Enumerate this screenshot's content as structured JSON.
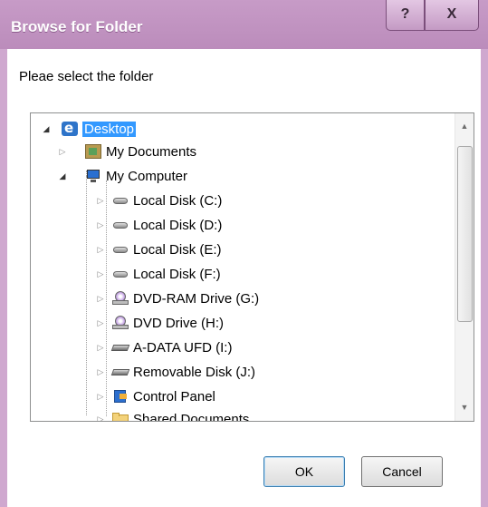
{
  "window": {
    "title": "Browse for Folder",
    "help_label": "?",
    "close_label": "X"
  },
  "prompt": "Pleae select the folder",
  "tree": {
    "items": [
      {
        "label": "Desktop",
        "icon": "desktop-icon",
        "selected": true
      },
      {
        "label": "My Documents",
        "icon": "my-documents-icon"
      },
      {
        "label": "My Computer",
        "icon": "my-computer-icon"
      },
      {
        "label": "Local Disk (C:)",
        "icon": "hard-disk-icon"
      },
      {
        "label": "Local Disk (D:)",
        "icon": "hard-disk-icon"
      },
      {
        "label": "Local Disk (E:)",
        "icon": "hard-disk-icon"
      },
      {
        "label": "Local Disk (F:)",
        "icon": "hard-disk-icon"
      },
      {
        "label": "DVD-RAM Drive (G:)",
        "icon": "dvd-drive-icon"
      },
      {
        "label": "DVD Drive (H:)",
        "icon": "dvd-drive-icon"
      },
      {
        "label": "A-DATA UFD (I:)",
        "icon": "removable-drive-icon"
      },
      {
        "label": "Removable Disk (J:)",
        "icon": "removable-drive-icon"
      },
      {
        "label": "Control Panel",
        "icon": "control-panel-icon"
      },
      {
        "label": "Shared Documents",
        "icon": "folder-icon"
      }
    ]
  },
  "buttons": {
    "ok": "OK",
    "cancel": "Cancel"
  },
  "colors": {
    "title_bar": "#c79bc7",
    "selection": "#3399ff"
  }
}
